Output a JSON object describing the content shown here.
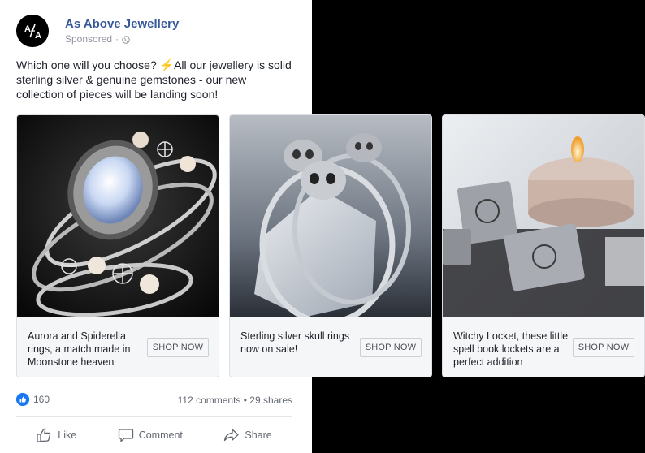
{
  "post": {
    "page_name": "As Above Jewellery",
    "sponsored_label": "Sponsored",
    "separator": "·",
    "avatar_letters": [
      "A",
      "A"
    ],
    "caption": "Which one will you choose? ⚡All our jewellery is solid sterling silver & genuine gemstones - our new collection of pieces will be landing soon!"
  },
  "cards": [
    {
      "text": "Aurora and Spiderella rings, a match made in Moonstone heaven",
      "button": "SHOP NOW"
    },
    {
      "text": "Sterling silver skull rings now on sale!",
      "button": "SHOP NOW"
    },
    {
      "text": "Witchy Locket, these little spell book lockets are a perfect addition",
      "button": "SHOP NOW"
    }
  ],
  "engagement": {
    "likes": "160",
    "comments_shares": "112 comments • 29 shares"
  },
  "actions": {
    "like": "Like",
    "comment": "Comment",
    "share": "Share"
  },
  "colors": {
    "page_name": "#365899",
    "like_badge": "#1877f2",
    "card_background": "#f5f6f7"
  },
  "icons": [
    "globe-icon",
    "thumbs-up-icon",
    "comment-icon",
    "share-icon"
  ]
}
